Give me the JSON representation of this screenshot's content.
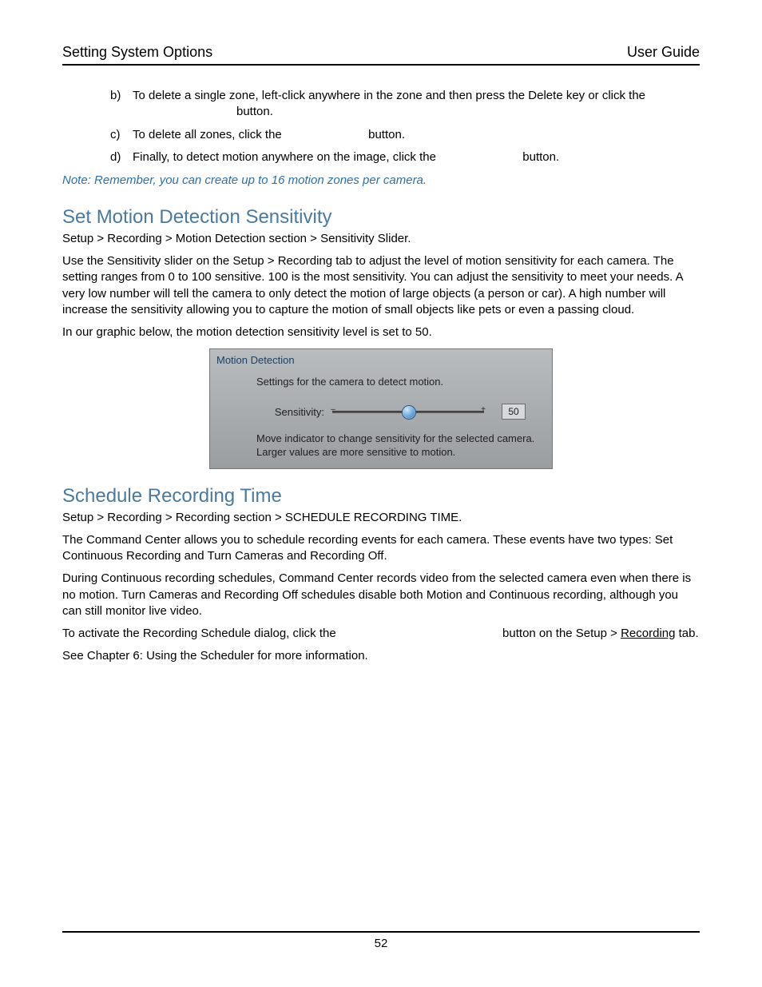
{
  "header": {
    "left": "Setting System Options",
    "right": "User Guide"
  },
  "list": {
    "b_key": "b)",
    "b_text1": "To delete a single zone, left-click anywhere in the zone and then press the Delete key or click the",
    "b_text2": "button.",
    "c_key": "c)",
    "c_text1": "To delete all zones, click the",
    "c_text2": "button.",
    "d_key": "d)",
    "d_text1": "Finally, to detect motion anywhere on the image, click the",
    "d_text2": "button."
  },
  "note": "Note: Remember, you can create up to 16 motion zones per camera.",
  "sec1": {
    "title": "Set Motion Detection Sensitivity",
    "bc": "Setup > Recording > Motion Detection section > Sensitivity Slider.",
    "p1": "Use the Sensitivity slider on the Setup > Recording tab to adjust the level of motion sensitivity for each camera. The setting ranges from 0 to 100 sensitive. 100 is the most sensitivity.  You can adjust the sensitivity to meet your needs. A very low number will tell the camera to only detect the motion of large objects (a person or car). A high number will increase the sensitivity allowing you to capture the motion of small objects like pets or even a passing cloud.",
    "p2": "In our graphic below, the motion detection sensitivity level is set to 50."
  },
  "panel": {
    "title": "Motion Detection",
    "line1": "Settings for the camera to detect motion.",
    "slider_label": "Sensitivity:",
    "minus": "–",
    "plus": "+",
    "value": "50",
    "help1": "Move indicator to change sensitivity for the selected camera.",
    "help2": "Larger values are more sensitive to motion."
  },
  "sec2": {
    "title": "Schedule Recording Time",
    "bc_prefix": "Setup > Recording > Recording section > ",
    "bc_sc": "SCHEDULE RECORDING TIME.",
    "p1": "The Command Center allows you to schedule recording events for each camera. These events have two types: Set Continuous Recording and Turn Cameras and Recording Off.",
    "p2": "During Continuous recording schedules, Command Center records video from the selected camera even when there is no motion. Turn Cameras and Recording Off schedules disable both Motion and Continuous recording, although you can still monitor live video.",
    "p3a": "To activate the Recording Schedule dialog, click the",
    "p3b": "button on the Setup > ",
    "p3c": "Recording",
    "p3d": " tab.",
    "p4": "See Chapter 6: Using the Scheduler for more information."
  },
  "page_number": "52"
}
